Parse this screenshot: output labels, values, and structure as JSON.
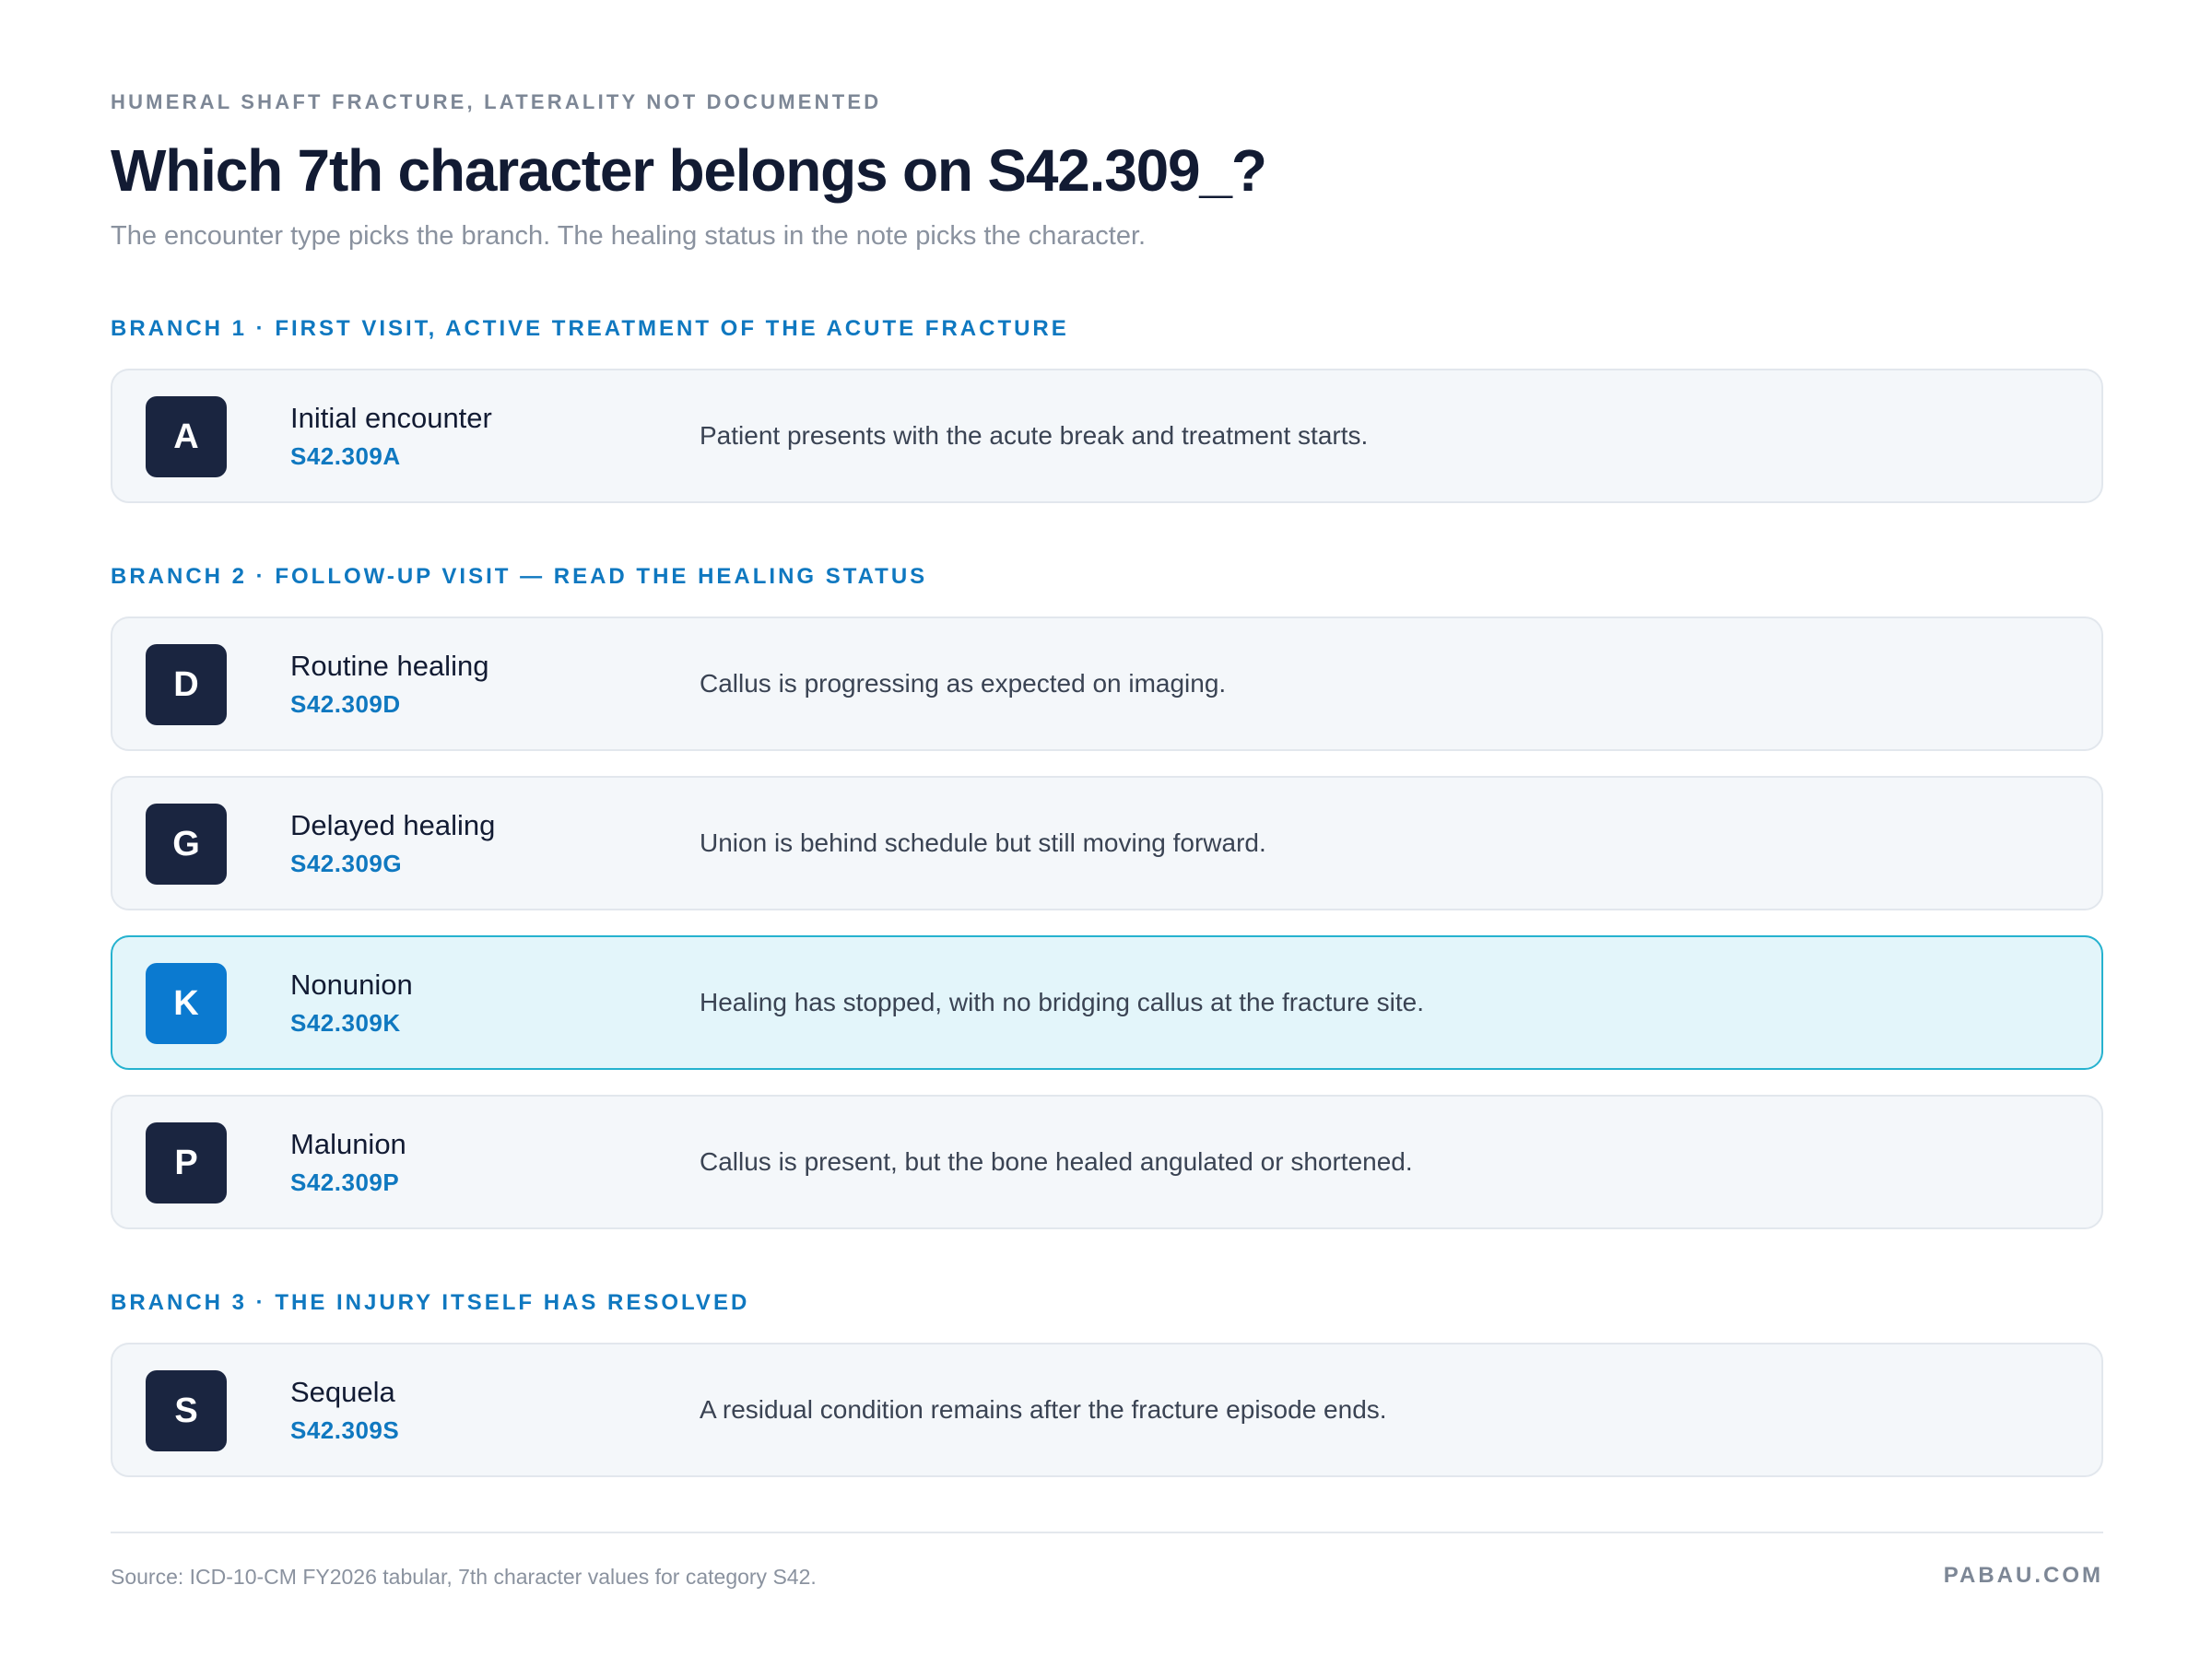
{
  "header": {
    "eyebrow": "HUMERAL SHAFT FRACTURE, LATERALITY NOT DOCUMENTED",
    "title": "Which 7th character belongs on S42.309_?",
    "subtitle": "The encounter type picks the branch. The healing status in the note picks the character."
  },
  "branches": [
    {
      "label": "BRANCH 1 · FIRST VISIT, ACTIVE TREATMENT OF THE ACUTE FRACTURE",
      "items": [
        {
          "letter": "A",
          "name": "Initial encounter",
          "code": "S42.309A",
          "description": "Patient presents with the acute break and treatment starts.",
          "highlighted": false
        }
      ]
    },
    {
      "label": "BRANCH 2 · FOLLOW-UP VISIT — READ THE HEALING STATUS",
      "items": [
        {
          "letter": "D",
          "name": "Routine healing",
          "code": "S42.309D",
          "description": "Callus is progressing as expected on imaging.",
          "highlighted": false
        },
        {
          "letter": "G",
          "name": "Delayed healing",
          "code": "S42.309G",
          "description": "Union is behind schedule but still moving forward.",
          "highlighted": false
        },
        {
          "letter": "K",
          "name": "Nonunion",
          "code": "S42.309K",
          "description": "Healing has stopped, with no bridging callus at the fracture site.",
          "highlighted": true
        },
        {
          "letter": "P",
          "name": "Malunion",
          "code": "S42.309P",
          "description": "Callus is present, but the bone healed angulated or shortened.",
          "highlighted": false
        }
      ]
    },
    {
      "label": "BRANCH 3 · THE INJURY ITSELF HAS RESOLVED",
      "items": [
        {
          "letter": "S",
          "name": "Sequela",
          "code": "S42.309S",
          "description": "A residual condition remains after the fracture episode ends.",
          "highlighted": false
        }
      ]
    }
  ],
  "footer": {
    "source": "Source: ICD-10-CM FY2026 tabular, 7th character values for category S42.",
    "brand": "PABAU.COM"
  },
  "colors": {
    "accent": "#0f78c0",
    "badge_dark": "#1a2540",
    "badge_highlight": "#0b7ad0",
    "highlight_bg": "#e3f5fa",
    "highlight_border": "#26b2cf"
  }
}
